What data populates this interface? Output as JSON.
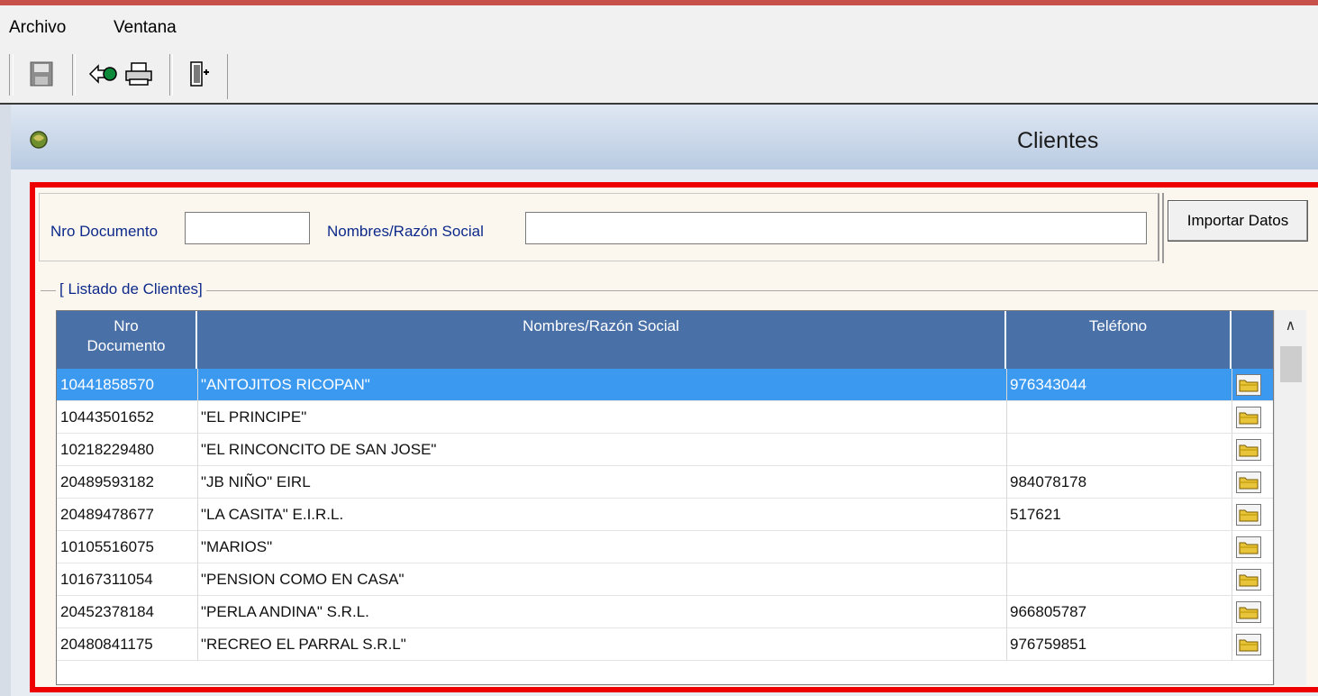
{
  "menubar": {
    "items": [
      "Archivo",
      "Ventana"
    ]
  },
  "toolbar": {
    "buttons": [
      "save-icon",
      "back-icon",
      "print-icon",
      "exit-icon"
    ]
  },
  "window": {
    "title": "Clientes"
  },
  "search": {
    "doc_label": "Nro Documento",
    "doc_value": "",
    "name_label": "Nombres/Razón Social",
    "name_value": "",
    "import_label": "Importar Datos"
  },
  "list": {
    "legend": "[ Listado de Clientes]",
    "columns": {
      "doc_line1": "Nro",
      "doc_line2": "Documento",
      "name": "Nombres/Razón Social",
      "phone": "Teléfono"
    },
    "rows": [
      {
        "doc": "10441858570",
        "name": "\"ANTOJITOS RICOPAN\"",
        "phone": "976343044",
        "selected": true
      },
      {
        "doc": "10443501652",
        "name": "\"EL PRINCIPE\"",
        "phone": ""
      },
      {
        "doc": "10218229480",
        "name": "\"EL RINCONCITO DE SAN JOSE\"",
        "phone": ""
      },
      {
        "doc": "20489593182",
        "name": "\"JB NIÑO\" EIRL",
        "phone": "984078178"
      },
      {
        "doc": "20489478677",
        "name": "\"LA CASITA\" E.I.R.L.",
        "phone": "517621"
      },
      {
        "doc": "10105516075",
        "name": "\"MARIOS\"",
        "phone": ""
      },
      {
        "doc": "10167311054",
        "name": "\"PENSION COMO EN CASA\"",
        "phone": ""
      },
      {
        "doc": "20452378184",
        "name": "\"PERLA ANDINA\"  S.R.L.",
        "phone": "966805787"
      },
      {
        "doc": "20480841175",
        "name": "\"RECREO EL PARRAL S.R.L\"",
        "phone": "976759851"
      }
    ]
  },
  "colors": {
    "highlight_frame": "#ee0000",
    "header_bg": "#4a70a8",
    "selected_row": "#3b9af0",
    "label_text": "#0d2a8a"
  }
}
